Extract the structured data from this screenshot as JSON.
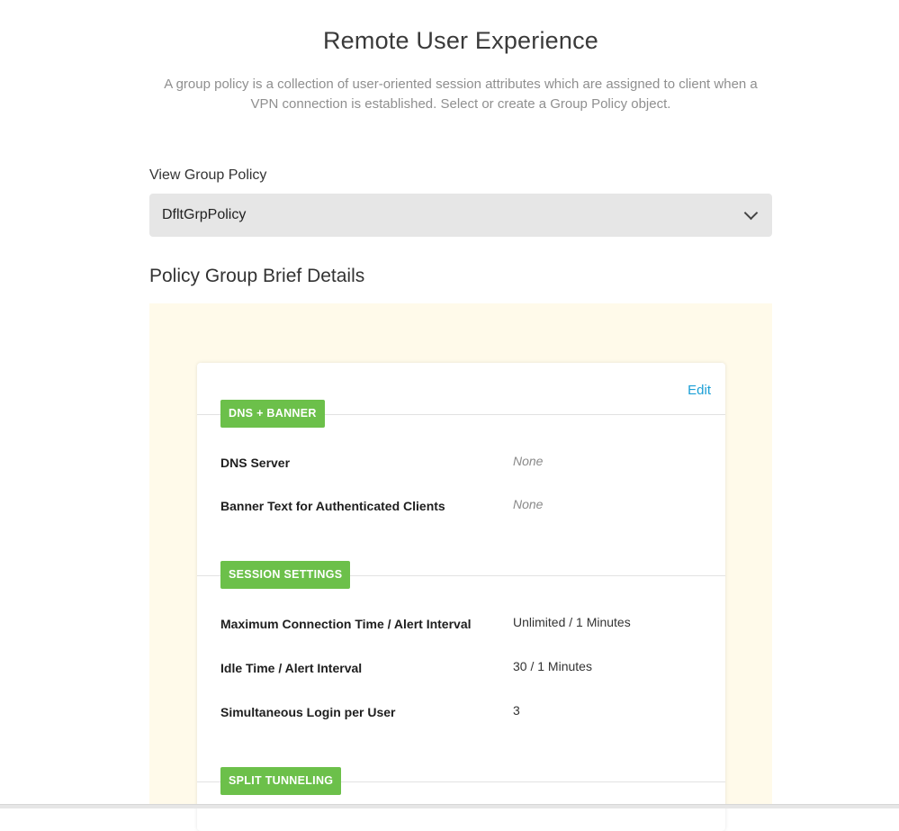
{
  "page": {
    "title": "Remote User Experience",
    "description": "A group policy is a collection of user-oriented session attributes which are assigned to client when a VPN connection is established. Select or create a Group Policy object."
  },
  "group_policy_select": {
    "label": "View Group Policy",
    "value": "DfltGrpPolicy"
  },
  "details": {
    "heading": "Policy Group Brief Details",
    "edit_label": "Edit",
    "groups": [
      {
        "badge": "DNS + BANNER",
        "rows": [
          {
            "label": "DNS Server",
            "value": "None"
          },
          {
            "label": "Banner Text for Authenticated Clients",
            "value": "None"
          }
        ]
      },
      {
        "badge": "SESSION SETTINGS",
        "rows": [
          {
            "label": "Maximum Connection Time / Alert Interval",
            "value": "Unlimited / 1 Minutes"
          },
          {
            "label": "Idle Time / Alert Interval",
            "value": "30 / 1 Minutes"
          },
          {
            "label": "Simultaneous Login per User",
            "value": "3"
          }
        ]
      },
      {
        "badge": "SPLIT TUNNELING",
        "rows": []
      }
    ]
  },
  "colors": {
    "badge_green": "#6cc04a",
    "link_blue": "#1b9fd6",
    "panel_background": "#fffaea",
    "select_background": "#e6e6e6"
  }
}
